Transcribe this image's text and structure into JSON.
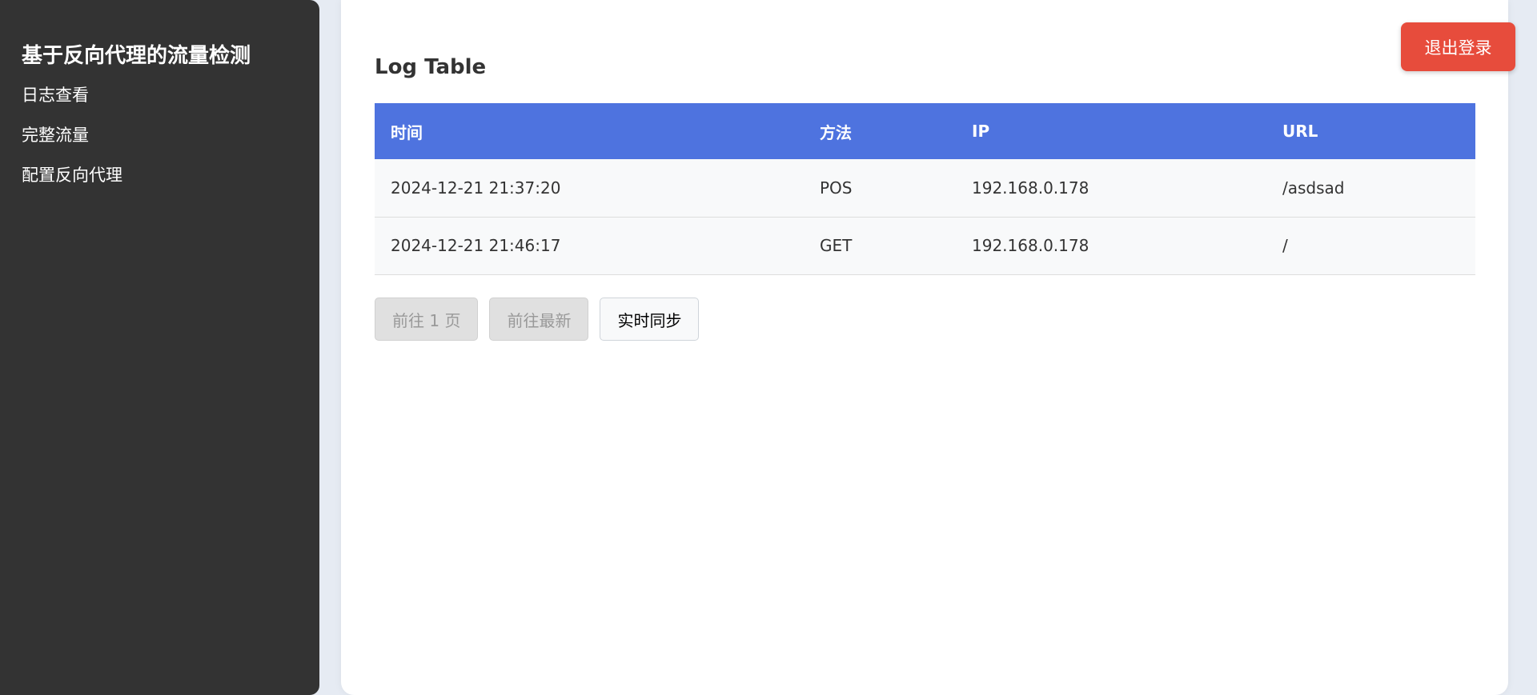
{
  "sidebar": {
    "title": "基于反向代理的流量检测",
    "items": [
      {
        "label": "日志查看"
      },
      {
        "label": "完整流量"
      },
      {
        "label": "配置反向代理"
      }
    ]
  },
  "header": {
    "logout_label": "退出登录"
  },
  "main": {
    "title": "Log Table",
    "table": {
      "columns": [
        "时间",
        "方法",
        "IP",
        "URL"
      ],
      "rows": [
        {
          "time": "2024-12-21 21:37:20",
          "method": "POS",
          "ip": "192.168.0.178",
          "url": "/asdsad"
        },
        {
          "time": "2024-12-21 21:46:17",
          "method": "GET",
          "ip": "192.168.0.178",
          "url": "/"
        }
      ]
    },
    "pager": {
      "prev_page_label": "前往 1 页",
      "latest_label": "前往最新",
      "sync_label": "实时同步"
    }
  },
  "colors": {
    "sidebar_bg": "#333333",
    "header_accent": "#4e73df",
    "logout_bg": "#e74c3c",
    "page_bg": "#e6ebf3"
  }
}
